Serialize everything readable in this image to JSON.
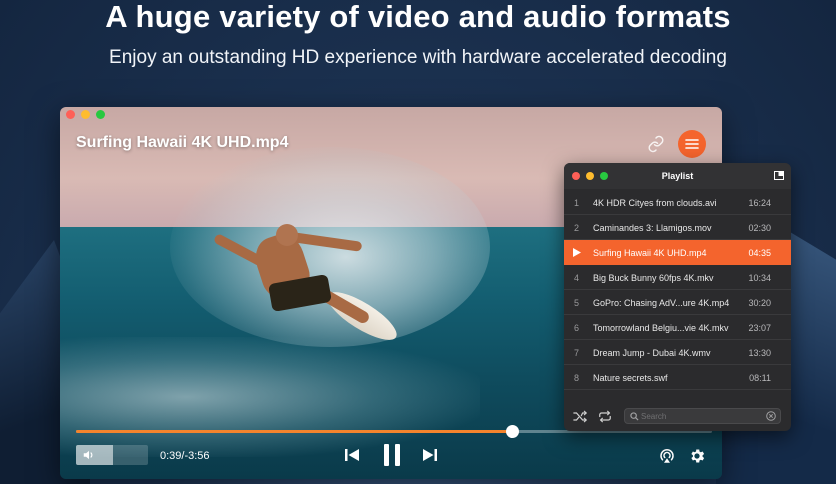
{
  "banner": {
    "headline": "A huge variety of video and audio formats",
    "subline": "Enjoy an outstanding HD experience with hardware accelerated decoding"
  },
  "player": {
    "title": "Surfing Hawaii 4K UHD.mp4",
    "time_display": "0:39/-3:56",
    "progress_fraction": 0.686,
    "volume_fraction": 0.52,
    "accent_color": "#f4642d"
  },
  "playlist": {
    "title": "Playlist",
    "search_placeholder": "Search",
    "items": [
      {
        "num": "1",
        "name": "4K HDR Cityes from clouds.avi",
        "duration": "16:24",
        "active": false
      },
      {
        "num": "2",
        "name": "Caminandes 3: Llamigos.mov",
        "duration": "02:30",
        "active": false
      },
      {
        "num": "3",
        "name": "Surfing Hawaii 4K UHD.mp4",
        "duration": "04:35",
        "active": true
      },
      {
        "num": "4",
        "name": "Big Buck Bunny 60fps 4K.mkv",
        "duration": "10:34",
        "active": false
      },
      {
        "num": "5",
        "name": "GoPro: Chasing AdV...ure 4K.mp4",
        "duration": "30:20",
        "active": false
      },
      {
        "num": "6",
        "name": "Tomorrowland Belgiu...vie 4K.mkv",
        "duration": "23:07",
        "active": false
      },
      {
        "num": "7",
        "name": "Dream Jump - Dubai 4K.wmv",
        "duration": "13:30",
        "active": false
      },
      {
        "num": "8",
        "name": "Nature secrets.swf",
        "duration": "08:11",
        "active": false
      }
    ]
  },
  "icons": {
    "link": "link-icon",
    "menu": "hamburger-menu-icon",
    "volume": "speaker-icon",
    "previous": "skip-back-icon",
    "pause": "pause-icon",
    "next": "skip-forward-icon",
    "airplay": "airplay-icon",
    "settings": "gear-icon",
    "shuffle": "shuffle-icon",
    "repeat": "repeat-icon",
    "search": "search-icon",
    "clear": "clear-icon",
    "pip": "picture-in-picture-icon"
  }
}
